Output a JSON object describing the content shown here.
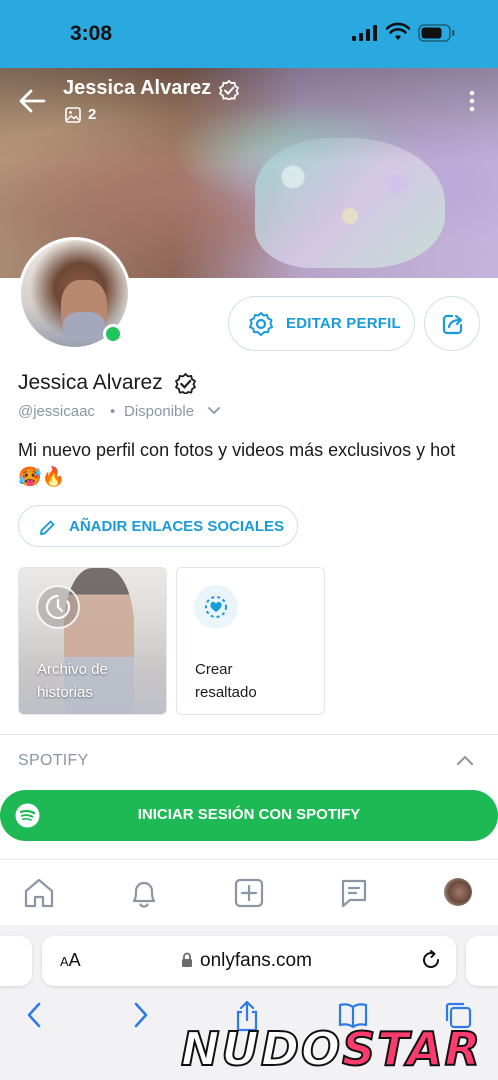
{
  "statusbar": {
    "time": "3:08"
  },
  "header": {
    "name": "Jessica Alvarez",
    "media_count": "2"
  },
  "profile": {
    "edit_label": "EDITAR PERFIL",
    "name": "Jessica Alvarez",
    "handle": "@jessicaac",
    "separator": "•",
    "status": "Disponible",
    "bio": "Mi nuevo perfil con fotos y videos más exclusivos y hot",
    "bio_emoji": "🥵🔥",
    "social_links_label": "AÑADIR ENLACES SOCIALES"
  },
  "highlights": [
    {
      "label": "Archivo de historias"
    },
    {
      "label": "Crear resaltado"
    }
  ],
  "spotify": {
    "title": "SPOTIFY",
    "login_label": "INICIAR SESIÓN CON SPOTIFY"
  },
  "browser": {
    "aa_big": "A",
    "aa_small": "A",
    "url": "onlyfans.com"
  },
  "watermark": {
    "part1": "NUDO",
    "part2": "STAR"
  },
  "colors": {
    "accent": "#1a9bd7",
    "spotify": "#1db954",
    "statusbar": "#2aa8e0",
    "online": "#21c55d"
  }
}
